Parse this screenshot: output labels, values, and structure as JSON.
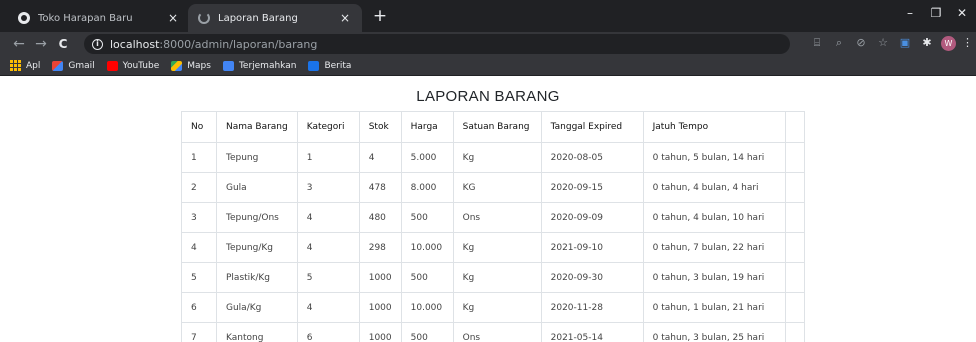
{
  "browser": {
    "tabs": [
      {
        "title": "Toko Harapan Baru",
        "close": "×"
      },
      {
        "title": "Laporan Barang",
        "close": "×"
      }
    ],
    "new_tab": "+",
    "window_controls": {
      "minimize": "–",
      "restore": "❐",
      "close": "✕"
    },
    "nav": {
      "back": "←",
      "forward": "→",
      "reload": "C"
    },
    "url": {
      "host": "localhost",
      "rest": ":8000/admin/laporan/barang"
    },
    "profile_initial": "W",
    "bookmarks": [
      "Apl",
      "Gmail",
      "YouTube",
      "Maps",
      "Terjemahkan",
      "Berita"
    ]
  },
  "page": {
    "title": "LAPORAN BARANG",
    "columns": [
      "No",
      "Nama Barang",
      "Kategori",
      "Stok",
      "Harga",
      "Satuan Barang",
      "Tanggal Expired",
      "Jatuh Tempo",
      ""
    ],
    "rows": [
      [
        "1",
        "Tepung",
        "1",
        "4",
        "5.000",
        "Kg",
        "2020-08-05",
        "0 tahun, 5 bulan, 14 hari",
        ""
      ],
      [
        "2",
        "Gula",
        "3",
        "478",
        "8.000",
        "KG",
        "2020-09-15",
        "0 tahun, 4 bulan, 4 hari",
        ""
      ],
      [
        "3",
        "Tepung/Ons",
        "4",
        "480",
        "500",
        "Ons",
        "2020-09-09",
        "0 tahun, 4 bulan, 10 hari",
        ""
      ],
      [
        "4",
        "Tepung/Kg",
        "4",
        "298",
        "10.000",
        "Kg",
        "2021-09-10",
        "0 tahun, 7 bulan, 22 hari",
        ""
      ],
      [
        "5",
        "Plastik/Kg",
        "5",
        "1000",
        "500",
        "Kg",
        "2020-09-30",
        "0 tahun, 3 bulan, 19 hari",
        ""
      ],
      [
        "6",
        "Gula/Kg",
        "4",
        "1000",
        "10.000",
        "Kg",
        "2020-11-28",
        "0 tahun, 1 bulan, 21 hari",
        ""
      ],
      [
        "7",
        "Kantong",
        "6",
        "1000",
        "500",
        "Ons",
        "2021-05-14",
        "0 tahun, 3 bulan, 25 hari",
        ""
      ]
    ]
  }
}
